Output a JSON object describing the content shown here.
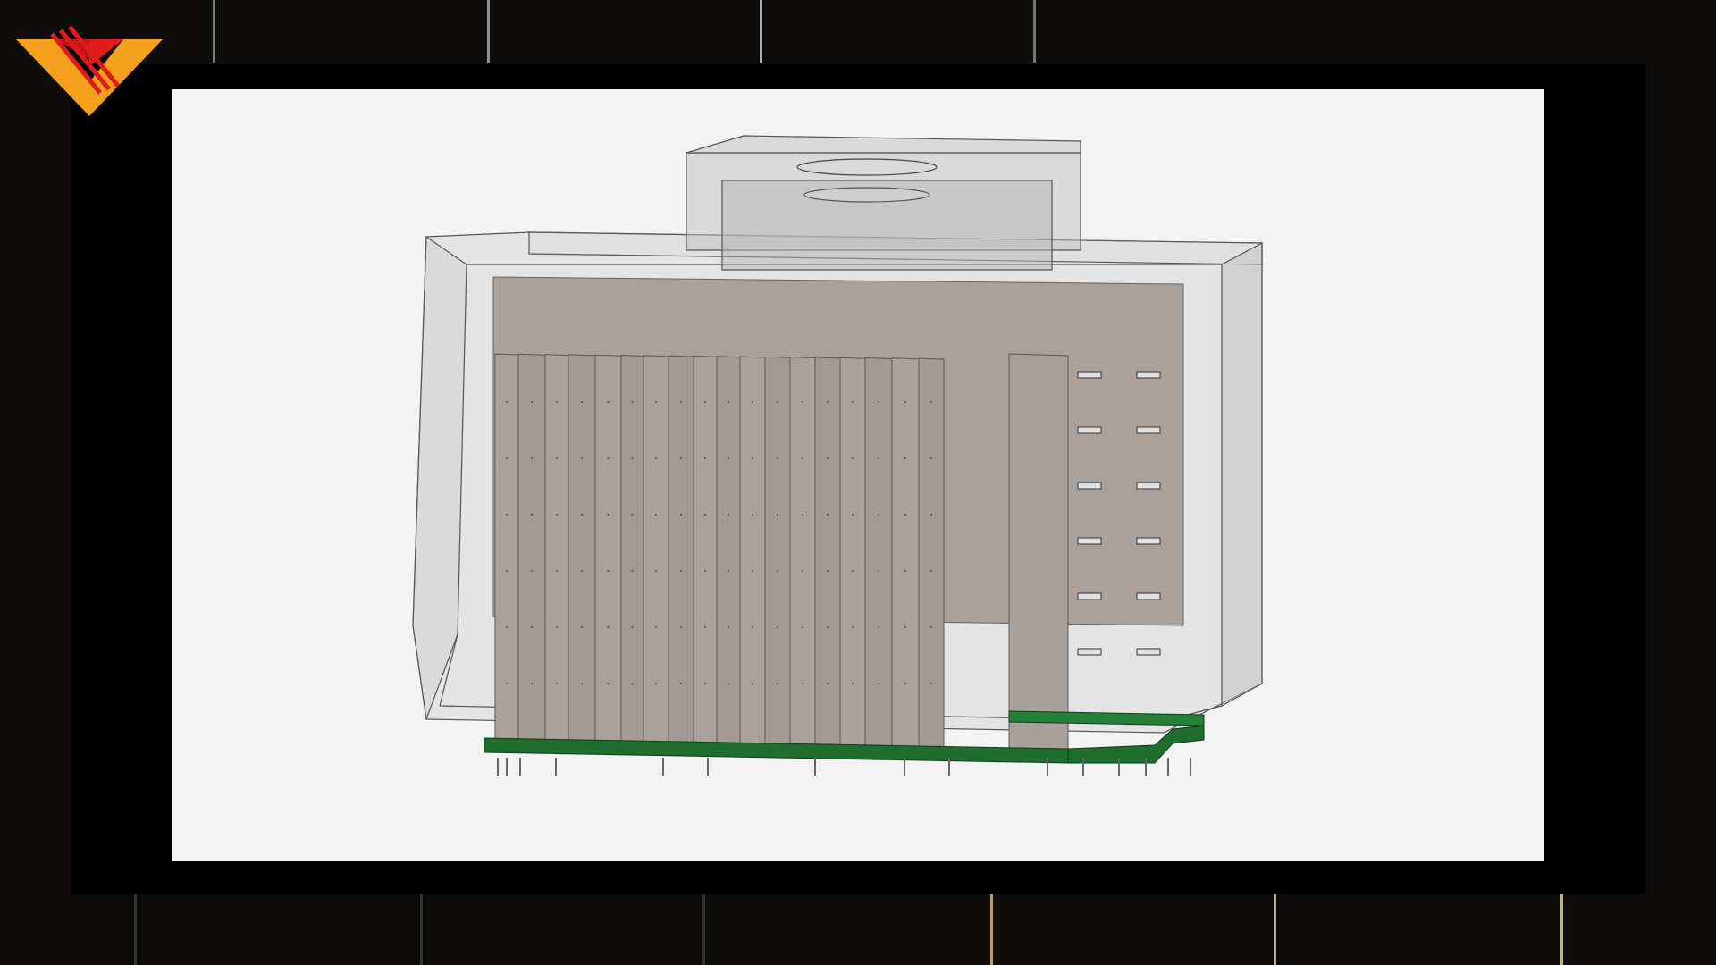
{
  "scene": {
    "logo_icon": "orange-v-chevron-logo-icon",
    "viewport_subject": "3d-cad-model-icon",
    "colors": {
      "background": "#0d0c0a",
      "bezel": "#000000",
      "viewport": "#f3f3f3",
      "enclosure_glass": "#c9c9c9",
      "panels": "#a69d96",
      "base_frame": "#1f6e2e",
      "logo_orange": "#f5a01a",
      "logo_red": "#e01b1b"
    }
  }
}
